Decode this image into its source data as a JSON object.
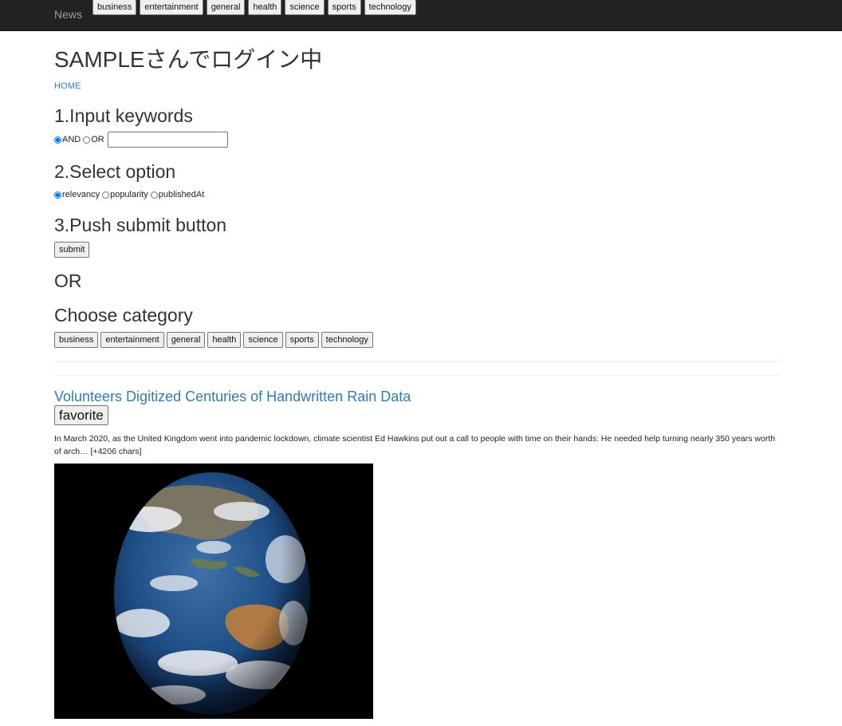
{
  "navbar": {
    "brand": "News",
    "categories": [
      "business",
      "entertainment",
      "general",
      "health",
      "science",
      "sports",
      "technology"
    ]
  },
  "page_title": "SAMPLEさんでログイン中",
  "home_link": "HOME",
  "step1": {
    "heading": "1.Input keywords",
    "and_label": "AND",
    "or_label": "OR",
    "keyword_value": ""
  },
  "step2": {
    "heading": "2.Select option",
    "options": [
      "relevancy",
      "popularity",
      "publishedAt"
    ],
    "selected": "relevancy"
  },
  "step3": {
    "heading": "3.Push submit button",
    "submit_label": "submit"
  },
  "or_heading": "OR",
  "category_section": {
    "heading": "Choose category",
    "categories": [
      "business",
      "entertainment",
      "general",
      "health",
      "science",
      "sports",
      "technology"
    ]
  },
  "article": {
    "title": "Volunteers Digitized Centuries of Handwritten Rain Data",
    "favorite_label": "favorite",
    "description": "In March 2020, as the United Kingdom went into pandemic lockdown, climate scientist Ed Hawkins put out a call to people with time on their hands: He needed help turning nearly 350 years worth of arch… [+4206 chars]",
    "image": "earth-globe-photo"
  },
  "colors": {
    "navbar_bg": "#222222",
    "link": "#337ab7",
    "text": "#333333"
  }
}
